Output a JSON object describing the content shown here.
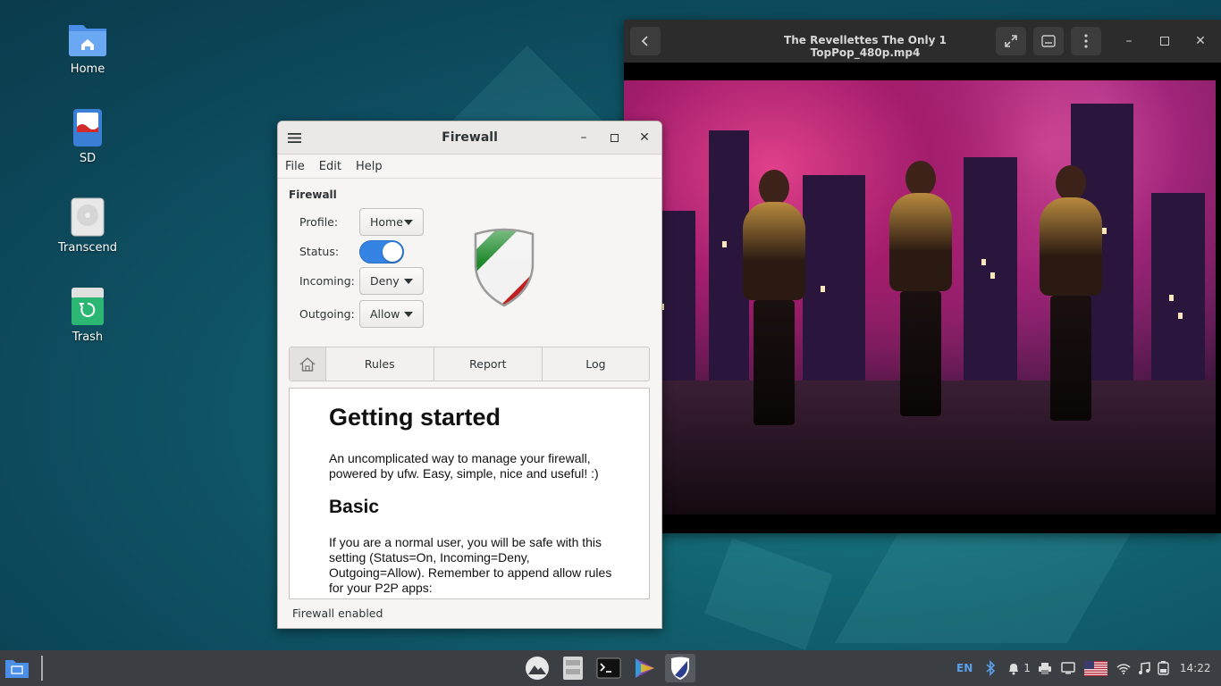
{
  "desktop": {
    "icons": [
      {
        "label": "Home"
      },
      {
        "label": "SD"
      },
      {
        "label": "Transcend"
      },
      {
        "label": "Trash"
      }
    ]
  },
  "firewall": {
    "title": "Firewall",
    "menu": [
      "File",
      "Edit",
      "Help"
    ],
    "section_title": "Firewall",
    "profile_label": "Profile:",
    "profile_value": "Home",
    "status_label": "Status:",
    "status_on": true,
    "incoming_label": "Incoming:",
    "incoming_value": "Deny",
    "outgoing_label": "Outgoing:",
    "outgoing_value": "Allow",
    "tabs": [
      "Rules",
      "Report",
      "Log"
    ],
    "content": {
      "heading": "Getting started",
      "intro": "An uncomplicated way to manage your firewall, powered by ufw. Easy, simple, nice and useful! :)",
      "subheading": "Basic",
      "basic_text": "If you are a normal user, you will be safe with this setting (Status=On, Incoming=Deny, Outgoing=Allow). Remember to append allow rules for your P2P apps:"
    },
    "status_bar": "Firewall enabled",
    "colors": {
      "switch_on": "#3584e4"
    }
  },
  "video_player": {
    "title": "The Revellettes  The Only 1  TopPop_480p.mp4"
  },
  "taskbar": {
    "keyboard_layout": "EN",
    "notification_count": "1",
    "clock": "14:22"
  }
}
